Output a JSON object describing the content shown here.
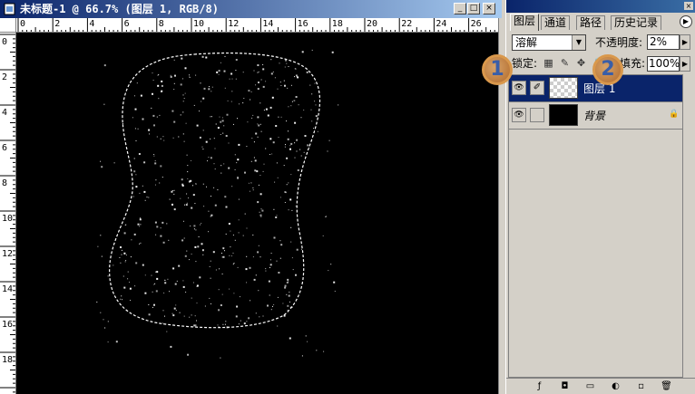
{
  "document": {
    "title": "未标题-1 @ 66.7% (图层 1, RGB/8)",
    "window_buttons": {
      "minimize": "_",
      "maximize": "□",
      "close": "×"
    },
    "ruler_top_labels": [
      "0",
      "2",
      "4",
      "6",
      "8",
      "10",
      "12",
      "14",
      "16",
      "18",
      "20",
      "22",
      "24",
      "26"
    ],
    "ruler_left_labels": [
      "0",
      "2",
      "4",
      "6",
      "8",
      "10",
      "12",
      "14",
      "16",
      "18"
    ]
  },
  "palette": {
    "tabs": [
      {
        "label": "图层",
        "active": true
      },
      {
        "label": "通道",
        "active": false
      },
      {
        "label": "路径",
        "active": false
      },
      {
        "label": "历史记录",
        "active": false
      }
    ],
    "blend_mode": "溶解",
    "opacity_label": "不透明度:",
    "opacity_value": "2%",
    "lock_label": "锁定:",
    "fill_label": "填充:",
    "fill_value": "100%",
    "layers": [
      {
        "name": "图层 1",
        "selected": true
      },
      {
        "name": "背景",
        "selected": false,
        "locked": true
      }
    ]
  },
  "callouts": [
    "1",
    "2"
  ],
  "colors": {
    "title_bar": "#0a246a",
    "selection": "#0a246a",
    "canvas": "#000000",
    "callout": "#d9984c"
  }
}
